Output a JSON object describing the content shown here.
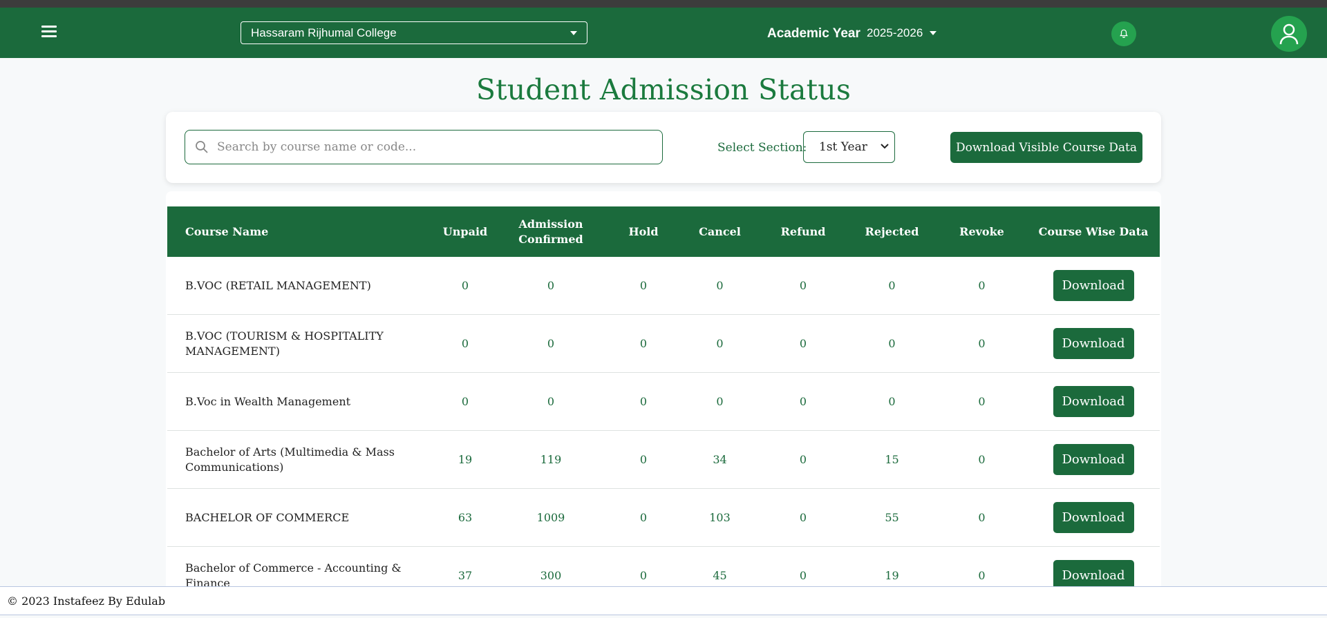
{
  "header": {
    "college": "Hassaram Rijhumal College",
    "academic_year_label": "Academic Year",
    "academic_year": "2025-2026"
  },
  "page_title": "Student Admission Status",
  "filters": {
    "search_placeholder": "Search by course name or code...",
    "section_label": "Select Section:",
    "section_value": "1st Year",
    "download_visible_label": "Download Visible Course Data"
  },
  "table": {
    "headers": {
      "course_name": "Course Name",
      "unpaid": "Unpaid",
      "admission_confirmed": "Admission Confirmed",
      "hold": "Hold",
      "cancel": "Cancel",
      "refund": "Refund",
      "rejected": "Rejected",
      "revoke": "Revoke",
      "course_wise_data": "Course Wise Data"
    },
    "download_label": "Download",
    "rows": [
      {
        "course": "B.VOC (RETAIL MANAGEMENT)",
        "unpaid": "0",
        "confirmed": "0",
        "hold": "0",
        "cancel": "0",
        "refund": "0",
        "rejected": "0",
        "revoke": "0"
      },
      {
        "course": "B.VOC (TOURISM & HOSPITALITY MANAGEMENT)",
        "unpaid": "0",
        "confirmed": "0",
        "hold": "0",
        "cancel": "0",
        "refund": "0",
        "rejected": "0",
        "revoke": "0"
      },
      {
        "course": "B.Voc in Wealth Management",
        "unpaid": "0",
        "confirmed": "0",
        "hold": "0",
        "cancel": "0",
        "refund": "0",
        "rejected": "0",
        "revoke": "0"
      },
      {
        "course": "Bachelor of Arts (Multimedia & Mass Communications)",
        "unpaid": "19",
        "confirmed": "119",
        "hold": "0",
        "cancel": "34",
        "refund": "0",
        "rejected": "15",
        "revoke": "0"
      },
      {
        "course": "BACHELOR OF COMMERCE",
        "unpaid": "63",
        "confirmed": "1009",
        "hold": "0",
        "cancel": "103",
        "refund": "0",
        "rejected": "55",
        "revoke": "0"
      },
      {
        "course": "Bachelor of Commerce - Accounting & Finance",
        "unpaid": "37",
        "confirmed": "300",
        "hold": "0",
        "cancel": "45",
        "refund": "0",
        "rejected": "19",
        "revoke": "0"
      }
    ]
  },
  "footer": {
    "text": "© 2023 Instafeez By Edulab"
  },
  "colors": {
    "primary": "#1b6a3c",
    "accent": "#25a24f",
    "title": "#1b7a3e"
  }
}
